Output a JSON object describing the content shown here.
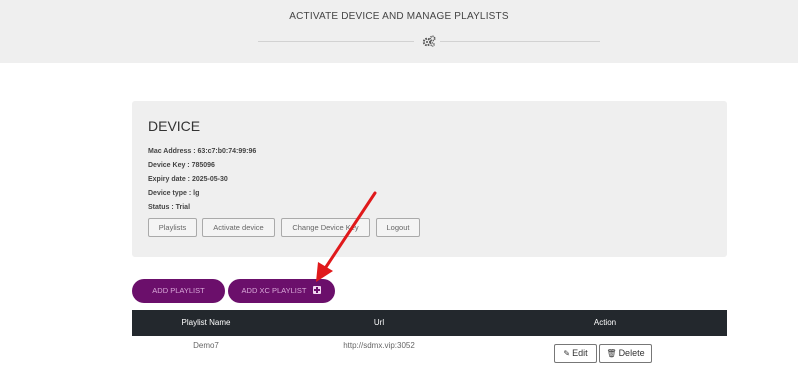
{
  "header": {
    "title": "ACTIVATE DEVICE AND MANAGE PLAYLISTS",
    "icon": "gears-icon"
  },
  "device": {
    "title": "DEVICE",
    "info": [
      {
        "label": "Mac Address",
        "value": "63:c7:b0:74:99:96",
        "text": "Mac Address : 63:c7:b0:74:99:96"
      },
      {
        "label": "Device Key",
        "value": "785096",
        "text": "Device Key : 785096"
      },
      {
        "label": "Expiry date",
        "value": "2025-05-30",
        "text": "Expiry date : 2025-05-30"
      },
      {
        "label": "Device type",
        "value": "lg",
        "text": "Device type : lg"
      },
      {
        "label": "Status",
        "value": "Trial",
        "text": "Status : Trial"
      }
    ],
    "buttons": {
      "playlists": "Playlists",
      "activate": "Activate device",
      "change_key": "Change Device Key",
      "logout": "Logout"
    }
  },
  "actions": {
    "add_playlist": "ADD PLAYLIST",
    "add_xc_playlist": "ADD XC PLAYLIST"
  },
  "table": {
    "headers": [
      "Playlist Name",
      "Url",
      "Action"
    ],
    "rows": [
      {
        "name": "Demo7",
        "url": "http://sdmx.vip:3052",
        "edit": "Edit",
        "delete": "Delete"
      }
    ]
  },
  "colors": {
    "accent": "#6b0f6b",
    "table_header": "#23282d",
    "annotation_arrow": "#e0191b"
  }
}
